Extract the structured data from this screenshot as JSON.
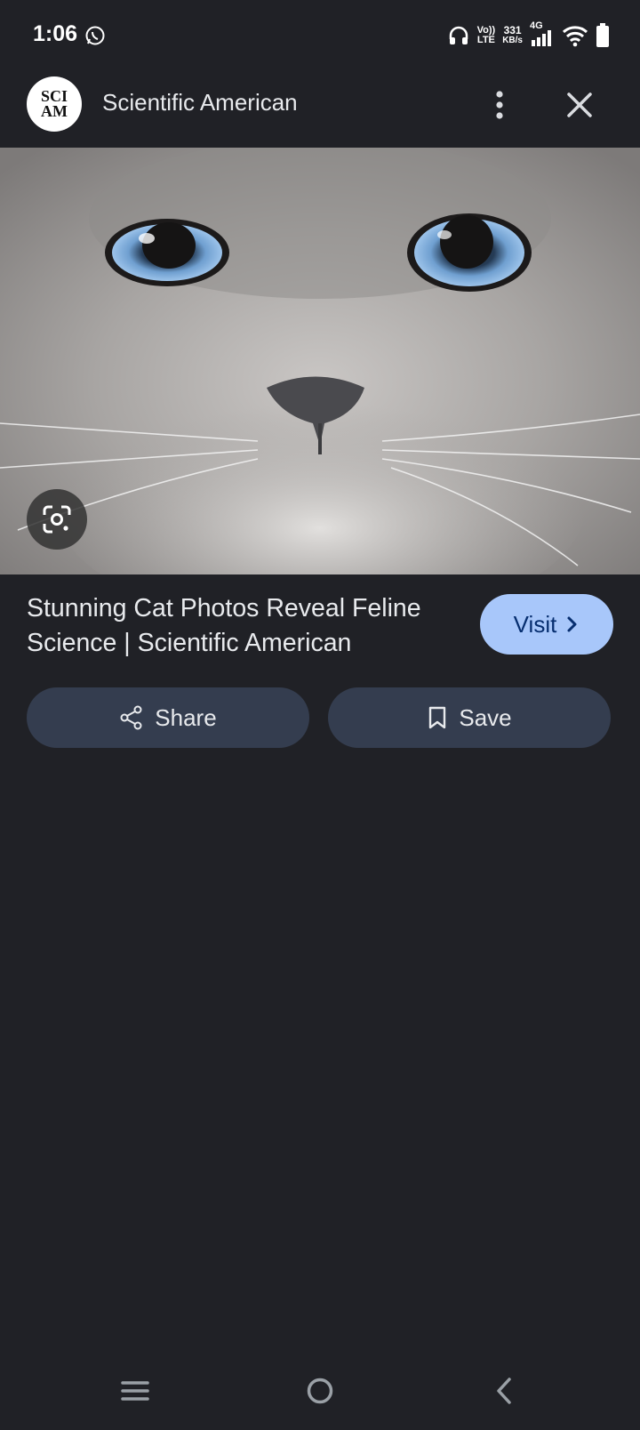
{
  "status_bar": {
    "time": "1:06",
    "volte_top": "Vo))",
    "volte_bottom": "LTE",
    "speed_value": "331",
    "speed_unit": "KB/s",
    "network": "4G"
  },
  "header": {
    "logo_line1": "SCI",
    "logo_line2": "AM",
    "site_name": "Scientific American"
  },
  "result": {
    "title": "Stunning Cat Photos Reveal Feline Science | Scientific American",
    "visit_label": "Visit",
    "share_label": "Share",
    "save_label": "Save"
  },
  "colors": {
    "background": "#202126",
    "visit_button": "#a8c7fa",
    "action_button": "#343d4f"
  },
  "icons": {
    "status": [
      "whatsapp-icon",
      "headphones-icon",
      "signal-icon",
      "wifi-icon",
      "battery-icon"
    ],
    "header": [
      "more-vert-icon",
      "close-icon"
    ],
    "image": [
      "google-lens-icon"
    ],
    "actions": [
      "chevron-right-icon",
      "share-icon",
      "bookmark-icon"
    ],
    "nav": [
      "menu-icon",
      "home-icon",
      "back-icon"
    ]
  }
}
